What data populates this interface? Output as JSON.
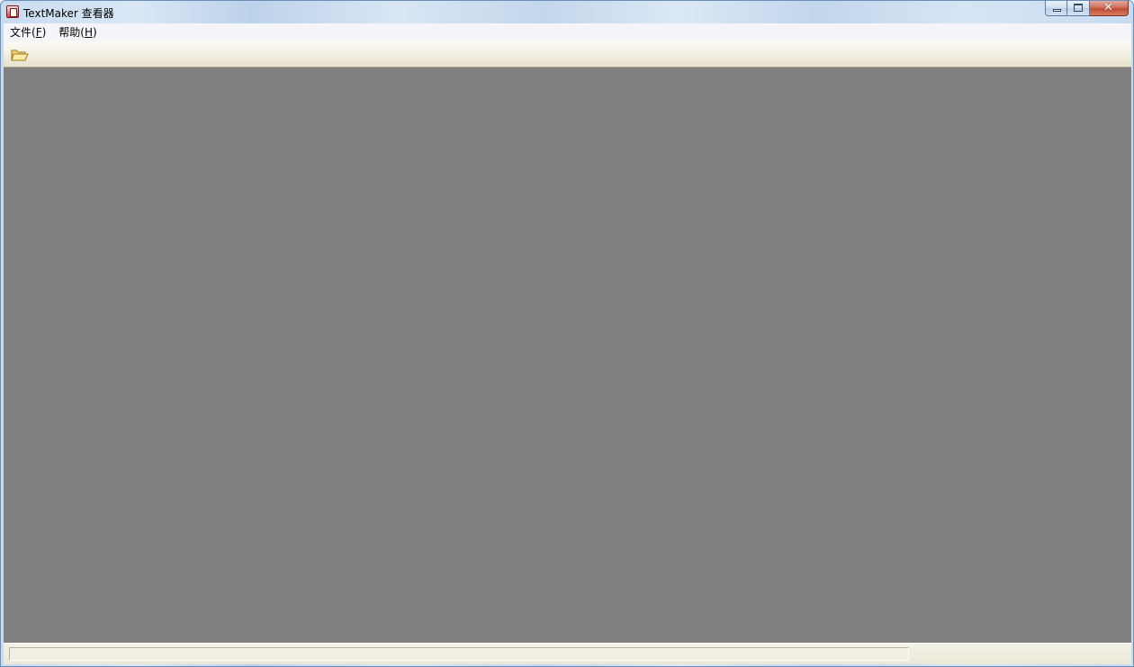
{
  "window": {
    "title": "TextMaker 查看器",
    "icon": "textmaker-app-icon",
    "caption_buttons": {
      "minimize_icon": "minimize-icon",
      "maximize_icon": "maximize-icon",
      "close_icon": "close-icon",
      "close_glyph": "✕"
    }
  },
  "menubar": {
    "items": [
      {
        "label": "文件(",
        "mnemonic": "F",
        "suffix": ")"
      },
      {
        "label": "帮助(",
        "mnemonic": "H",
        "suffix": ")"
      }
    ]
  },
  "toolbar": {
    "buttons": [
      {
        "icon": "open-folder-icon"
      }
    ]
  },
  "statusbar": {
    "text": ""
  },
  "colors": {
    "workspace": "#808080",
    "menubar": "#f5f4f8",
    "close_button": "#c14a31"
  }
}
